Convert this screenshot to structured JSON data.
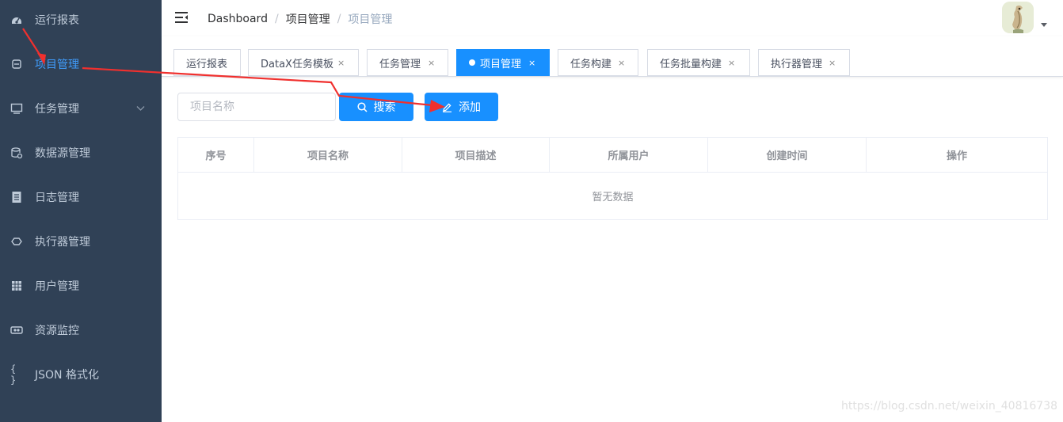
{
  "sidebar": {
    "items": [
      {
        "label": "运行报表",
        "icon": "dashboard-icon",
        "active": false
      },
      {
        "label": "项目管理",
        "icon": "project-icon",
        "active": true
      },
      {
        "label": "任务管理",
        "icon": "monitor-icon",
        "active": false,
        "expandable": true
      },
      {
        "label": "数据源管理",
        "icon": "datasource-icon",
        "active": false
      },
      {
        "label": "日志管理",
        "icon": "log-icon",
        "active": false
      },
      {
        "label": "执行器管理",
        "icon": "executor-icon",
        "active": false
      },
      {
        "label": "用户管理",
        "icon": "user-grid-icon",
        "active": false
      },
      {
        "label": "资源监控",
        "icon": "resource-monitor-icon",
        "active": false
      },
      {
        "label": "JSON 格式化",
        "icon": "braces-icon",
        "active": false
      }
    ]
  },
  "breadcrumb": [
    "Dashboard",
    "项目管理",
    "项目管理"
  ],
  "tags": [
    {
      "label": "运行报表",
      "closable": false,
      "active": false
    },
    {
      "label": "DataX任务模板",
      "closable": true,
      "active": false
    },
    {
      "label": "任务管理",
      "closable": true,
      "active": false
    },
    {
      "label": "项目管理",
      "closable": true,
      "active": true
    },
    {
      "label": "任务构建",
      "closable": true,
      "active": false
    },
    {
      "label": "任务批量构建",
      "closable": true,
      "active": false
    },
    {
      "label": "执行器管理",
      "closable": true,
      "active": false
    }
  ],
  "tag_close_glyph": "×",
  "filter": {
    "search_placeholder": "项目名称",
    "search_value": "",
    "search_button": "搜索",
    "add_button": "添加"
  },
  "table": {
    "columns": [
      "序号",
      "项目名称",
      "项目描述",
      "所属用户",
      "创建时间",
      "操作"
    ],
    "rows": [],
    "empty_text": "暂无数据"
  },
  "watermark": "https://blog.csdn.net/weixin_40816738",
  "colors": {
    "sidebar_bg": "#304156",
    "sidebar_text": "#bfcbd9",
    "active": "#409eff",
    "primary": "#1890ff",
    "annotation_arrow": "#f0302e"
  }
}
